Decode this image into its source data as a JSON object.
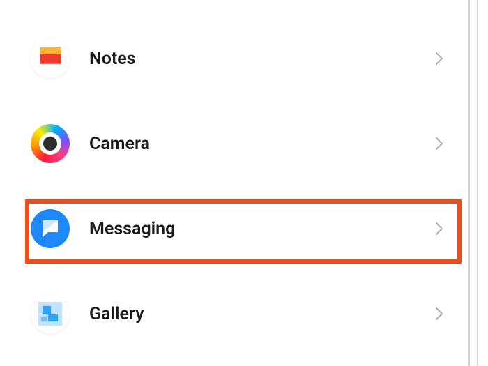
{
  "rows": [
    {
      "id": "notes",
      "label": "Notes",
      "icon": "notes-icon"
    },
    {
      "id": "camera",
      "label": "Camera",
      "icon": "camera-icon"
    },
    {
      "id": "messaging",
      "label": "Messaging",
      "icon": "messaging-icon"
    },
    {
      "id": "gallery",
      "label": "Gallery",
      "icon": "gallery-icon"
    }
  ],
  "highlighted_row": "messaging",
  "colors": {
    "highlight_border": "#f04d1f",
    "notes_top": "#f9b233",
    "notes_mid": "#f03a2e",
    "notes_bot": "#ffffff",
    "messaging_bg": "#1e88ff",
    "chevron": "#b0b0b0"
  }
}
